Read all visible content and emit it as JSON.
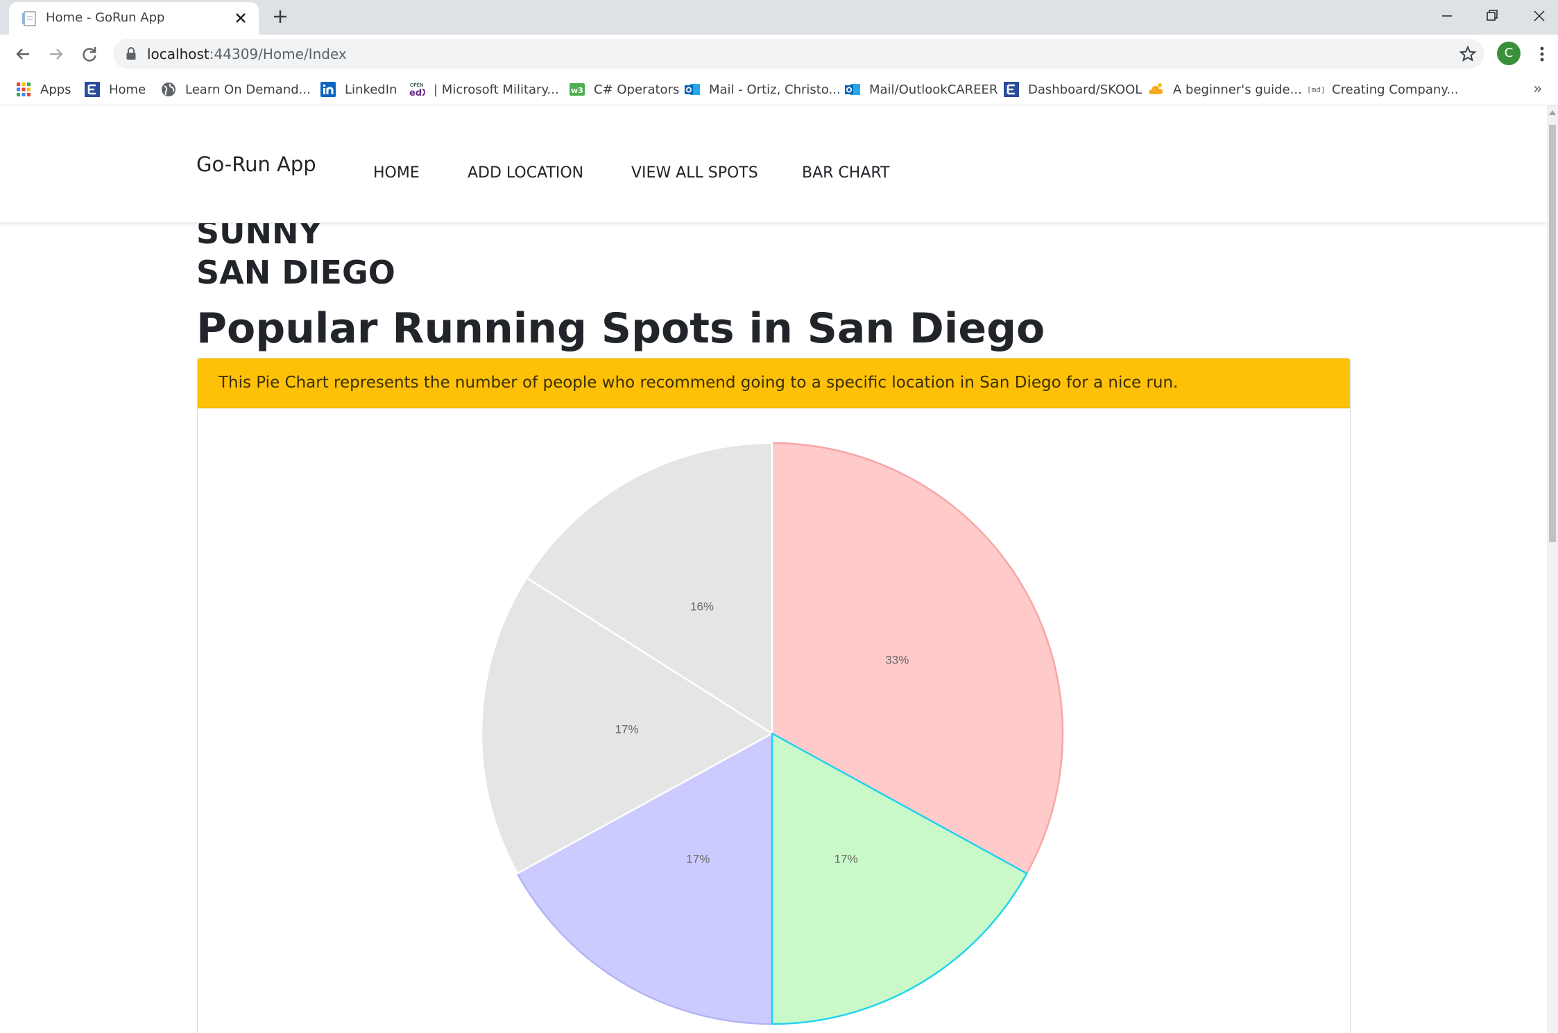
{
  "browser": {
    "tab_title": "Home - GoRun App",
    "url_host": "localhost",
    "url_rest": ":44309/Home/Index",
    "profile_initial": "C",
    "bookmarks": [
      {
        "label": "Apps",
        "icon": "apps-grid-icon"
      },
      {
        "label": "Home",
        "icon": "edmodo-e-icon"
      },
      {
        "label": "Learn On Demand...",
        "icon": "globe-icon"
      },
      {
        "label": "LinkedIn",
        "icon": "linkedin-icon"
      },
      {
        "label": "| Microsoft Military...",
        "icon": "edx-icon"
      },
      {
        "label": "C# Operators",
        "icon": "w3schools-icon"
      },
      {
        "label": "Mail - Ortiz, Christo...",
        "icon": "outlook-icon"
      },
      {
        "label": "Mail/OutlookCAREER",
        "icon": "outlook-icon"
      },
      {
        "label": "Dashboard/SKOOL",
        "icon": "edmodo-e-icon"
      },
      {
        "label": "A beginner's guide...",
        "icon": "cloud-icon"
      },
      {
        "label": "Creating Company...",
        "icon": "markdown-md-icon"
      }
    ]
  },
  "site": {
    "brand": "Go-Run App",
    "nav": [
      "HOME",
      "ADD LOCATION",
      "VIEW ALL SPOTS",
      "BAR CHART"
    ]
  },
  "page": {
    "weather_line1": "SUNNY",
    "weather_line2": "SAN DIEGO",
    "title": "Popular Running Spots in San Diego",
    "alert": "This Pie Chart represents the number of people who recommend going to a specific location in San Diego for a nice run."
  },
  "chart_data": {
    "type": "pie",
    "slices": [
      {
        "label": "33%",
        "value": 33,
        "fill": "#ffcaca",
        "stroke": "#f7a6a6"
      },
      {
        "label": "17%",
        "value": 17,
        "fill": "#c9f9c9",
        "stroke": "#20d4f0"
      },
      {
        "label": "17%",
        "value": 17,
        "fill": "#cccbff",
        "stroke": "#b3b2f5"
      },
      {
        "label": "17%",
        "value": 17,
        "fill": "#e5e5e5",
        "stroke": "#ffffff"
      },
      {
        "label": "16%",
        "value": 16,
        "fill": "#e5e5e5",
        "stroke": "#ffffff"
      }
    ]
  }
}
